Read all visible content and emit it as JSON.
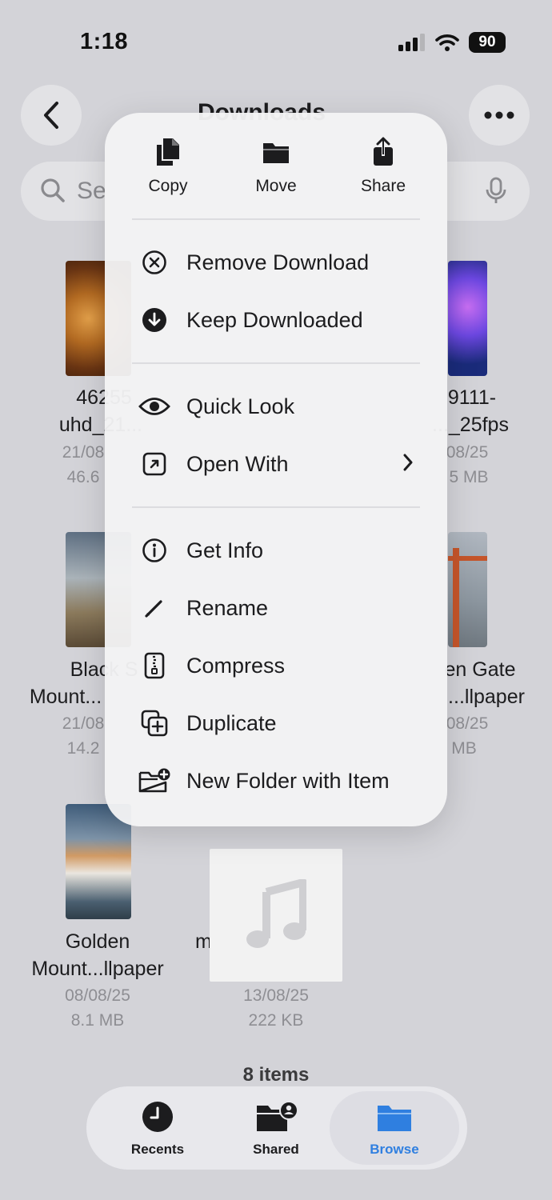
{
  "status_bar": {
    "time": "1:18",
    "battery": "90"
  },
  "nav": {
    "title": "Downloads"
  },
  "search": {
    "placeholder": "Se"
  },
  "files": [
    {
      "name1": "46255",
      "name2": "uhd_21...",
      "date": "21/08",
      "size": "46.6"
    },
    {
      "name1": "9111-",
      "name2": "..._25fps",
      "date": "08/25",
      "size": "5 MB"
    },
    {
      "name1": "Black S",
      "name2": "Mount...",
      "date": "21/08",
      "size": "14.2"
    },
    {
      "name1": "en Gate",
      "name2": "...llpaper",
      "date": "08/25",
      "size": "MB"
    },
    {
      "name1": "Golden",
      "name2": "Mount...llpaper",
      "date": "08/08/25",
      "size": "8.1 MB"
    },
    {
      "name1": "m",
      "name2": "",
      "date": "13/08/25",
      "size": "222 KB"
    }
  ],
  "menu": {
    "top_actions": [
      {
        "label": "Copy",
        "icon": "copy-icon"
      },
      {
        "label": "Move",
        "icon": "folder-icon"
      },
      {
        "label": "Share",
        "icon": "share-icon"
      }
    ],
    "items": [
      {
        "label": "Remove Download",
        "icon": "remove-circle-icon"
      },
      {
        "label": "Keep Downloaded",
        "icon": "download-circle-icon"
      },
      {
        "label": "Quick Look",
        "icon": "eye-icon"
      },
      {
        "label": "Open With",
        "icon": "open-external-icon"
      },
      {
        "label": "Get Info",
        "icon": "info-icon"
      },
      {
        "label": "Rename",
        "icon": "pencil-icon"
      },
      {
        "label": "Compress",
        "icon": "zip-icon"
      },
      {
        "label": "Duplicate",
        "icon": "duplicate-icon"
      },
      {
        "label": "New Folder with Item",
        "icon": "folder-plus-icon"
      }
    ]
  },
  "footer": {
    "items_count": "8 items"
  },
  "tabs": [
    {
      "label": "Recents",
      "icon": "clock-icon"
    },
    {
      "label": "Shared",
      "icon": "shared-folder-icon"
    },
    {
      "label": "Browse",
      "icon": "browse-folder-icon",
      "active": true
    }
  ],
  "colors": {
    "accent": "#2f7fe0",
    "background": "#d3d3d8",
    "menu_bg": "#f2f2f4"
  }
}
